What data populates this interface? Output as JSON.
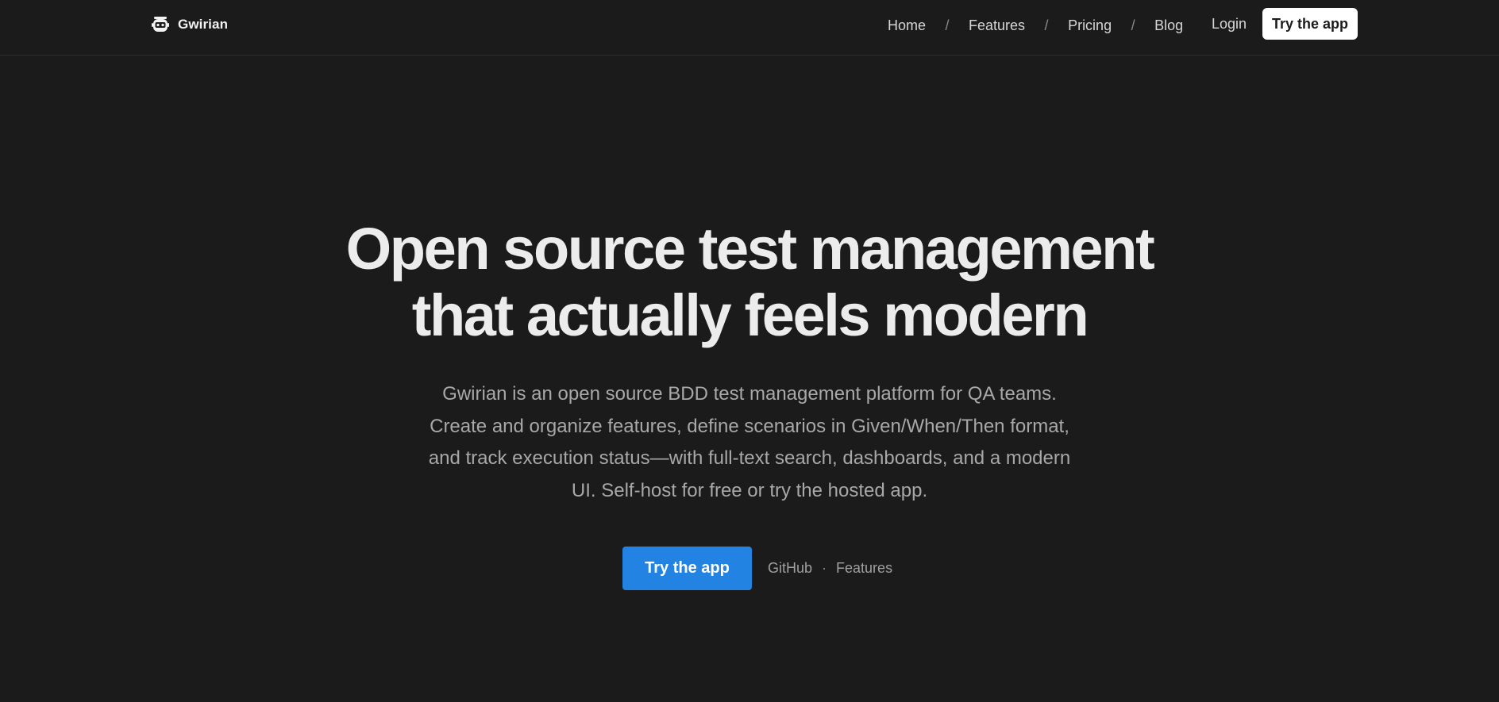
{
  "brand": {
    "name": "Gwirian",
    "logo_icon": "robot-icon"
  },
  "nav": {
    "items": [
      {
        "label": "Home"
      },
      {
        "label": "Features"
      },
      {
        "label": "Pricing"
      },
      {
        "label": "Blog"
      }
    ],
    "separator": "/",
    "login_label": "Login",
    "cta_label": "Try the app"
  },
  "hero": {
    "title_line1": "Open source test management",
    "title_line2": "that actually feels modern",
    "subtitle": "Gwirian is an open source BDD test management platform for QA teams. Create and organize features, define scenarios in Given/When/Then format, and track execution status—with full-text search, dashboards, and a modern UI. Self-host for free or try the hosted app.",
    "primary_cta_label": "Try the app",
    "github_label": "GitHub",
    "dot_separator": "·",
    "features_label": "Features"
  },
  "colors": {
    "background": "#1b1b1b",
    "primary_button": "#2283e2",
    "header_button_bg": "#ffffff",
    "text_primary": "#ececec",
    "text_muted": "#a8a8a8"
  }
}
